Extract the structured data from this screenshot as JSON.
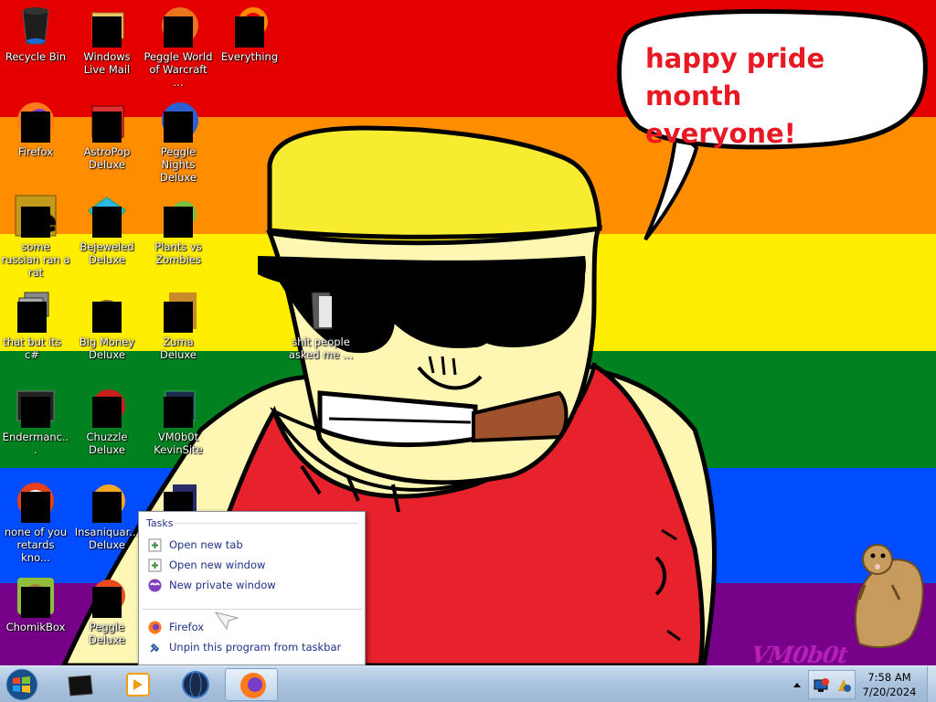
{
  "wallpaper": {
    "stripes": [
      "#e50000",
      "#ff8d00",
      "#ffee00",
      "#028121",
      "#004cff",
      "#770088"
    ],
    "speech_bubble_text_line1": "happy pride month",
    "speech_bubble_text_line2": "everyone!",
    "watermark": "VM0b0t"
  },
  "desktop_icons": [
    {
      "label": "Recycle Bin",
      "icon": "recycle-bin-icon"
    },
    {
      "label": "Windows Live Mail",
      "icon": "windows-live-mail-icon"
    },
    {
      "label": "Peggle World of Warcraft ...",
      "icon": "peggle-wow-icon"
    },
    {
      "label": "Everything",
      "icon": "everything-search-icon"
    },
    {
      "label": "Firefox",
      "icon": "firefox-icon"
    },
    {
      "label": "AstroPop Deluxe",
      "icon": "astropop-icon"
    },
    {
      "label": "Peggle Nights Deluxe",
      "icon": "peggle-nights-icon"
    },
    {
      "label": "some russian ran a rat",
      "icon": "shortcut-e-icon"
    },
    {
      "label": "Bejeweled Deluxe",
      "icon": "bejeweled-icon"
    },
    {
      "label": "Plants vs Zombies",
      "icon": "plants-vs-zombies-icon"
    },
    {
      "label": "that but its c#",
      "icon": "stacked-windows-icon"
    },
    {
      "label": "Big Money Deluxe",
      "icon": "big-money-icon"
    },
    {
      "label": "Zuma Deluxe",
      "icon": "zuma-icon"
    },
    {
      "label": "Endermanc...",
      "icon": "terminal-icon"
    },
    {
      "label": "Chuzzle Deluxe",
      "icon": "chuzzle-icon"
    },
    {
      "label": "VM0b0t KevinSite",
      "icon": "kevinsite-icon"
    },
    {
      "label": "none of you retards kno...",
      "icon": "red-swirl-icon"
    },
    {
      "label": "Insaniquar... Deluxe",
      "icon": "insaniquarium-icon"
    },
    {
      "label": "",
      "icon": "app-icon"
    },
    {
      "label": "ChomikBox",
      "icon": "chomikbox-icon"
    },
    {
      "label": "Peggle Deluxe",
      "icon": "peggle-icon"
    },
    {
      "label": "shit people asked me ...",
      "icon": "folder-icon"
    }
  ],
  "jump_list": {
    "section_title": "Tasks",
    "items": [
      {
        "label": "Open new tab",
        "icon": "new-tab-icon"
      },
      {
        "label": "Open new window",
        "icon": "new-window-icon"
      },
      {
        "label": "New private window",
        "icon": "private-window-icon"
      },
      {
        "label": "Firefox",
        "icon": "firefox-icon"
      },
      {
        "label": "Unpin this program from taskbar",
        "icon": "unpin-icon"
      }
    ]
  },
  "taskbar": {
    "pinned": [
      "file-explorer-icon",
      "windows-media-player-icon",
      "globe-browser-icon",
      "firefox-icon"
    ],
    "active_pinned": "firefox-icon",
    "clock_time": "7:58 AM",
    "clock_date": "7/20/2024",
    "colors": {
      "bar_top": "#c9dcee",
      "bar_bottom": "#9db7d5",
      "active_button": "#bcd3ea"
    }
  }
}
